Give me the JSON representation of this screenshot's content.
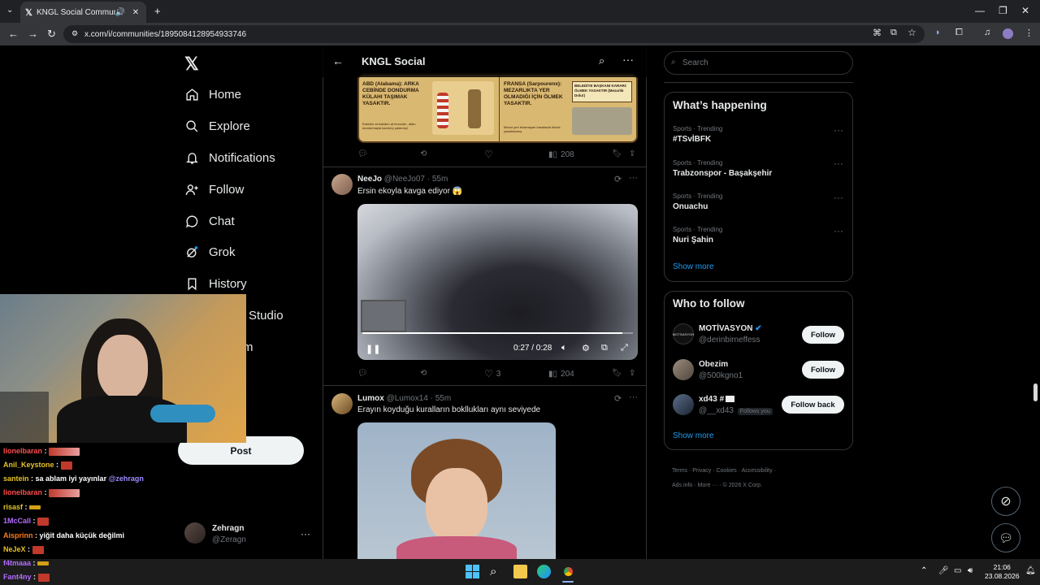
{
  "browser": {
    "tab_title": "KNGL Social Community / X",
    "url": "x.com/i/communities/1895084128954933746"
  },
  "nav": {
    "items": [
      {
        "label": "Home",
        "icon": "home-icon"
      },
      {
        "label": "Explore",
        "icon": "search-icon"
      },
      {
        "label": "Notifications",
        "icon": "bell-icon"
      },
      {
        "label": "Follow",
        "icon": "follow-icon"
      },
      {
        "label": "Chat",
        "icon": "chat-icon"
      },
      {
        "label": "Grok",
        "icon": "grok-icon"
      },
      {
        "label": "History",
        "icon": "bookmark-icon"
      },
      {
        "label": "Studio",
        "icon": "studio-icon"
      },
      {
        "label": "m",
        "icon": "premium-icon"
      }
    ],
    "post_label": "Post",
    "profile": {
      "name": "Zehragn",
      "handle": "@Zeragn"
    }
  },
  "main": {
    "title": "KNGL Social",
    "top_post": {
      "image_text_left": "ABD (Alabama): ARKA CEBİNDE DONDURMA KÜLAHI TAŞIMAK YASAKTIR.",
      "image_subtext_left": "Eskiden at eskiden at hırsızları, atları dondurmayla kandırıp çalarmış!",
      "image_text_right": "FRANSA (Sarpourenx): MEZARLIKTA YER OLMADIĞI İÇİN ÖLMEK YASAKTIR.",
      "image_subtext_right": "Mezar yeri bulamayan kasabada ölmek yasaklanmış",
      "image_sign": "BELEDİYE BAŞKANI KARARI: ÖLMEK YASAKTIR (Mezarlık Dolu!)",
      "views": "208"
    },
    "tweets": [
      {
        "name": "NeeJo",
        "handle": "@NeeJo07",
        "time": "· 55m",
        "text": "Ersin ekoyla kavga ediyor 😱",
        "video_time": "0:27 / 0:28",
        "video_progress": 0.96,
        "likes": "3",
        "views": "204"
      },
      {
        "name": "Lumox",
        "handle": "@Lumox14",
        "time": "· 55m",
        "text": "Erayın koyduğu kuralların bokllukları aynı seviyede"
      }
    ]
  },
  "right": {
    "search_placeholder": "Search",
    "happening_title": "What’s happening",
    "trends": [
      {
        "meta": "Sports · Trending",
        "name": "#TSvİBFK"
      },
      {
        "meta": "Sports · Trending",
        "name": "Trabzonspor - Başakşehir"
      },
      {
        "meta": "Sports · Trending",
        "name": "Onuachu"
      },
      {
        "meta": "Sports · Trending",
        "name": "Nuri Şahin"
      }
    ],
    "show_more": "Show more",
    "who_title": "Who to follow",
    "who": [
      {
        "name": "MOTİVASYON",
        "handle": "@derinbirneffess",
        "button": "Follow",
        "verified": true
      },
      {
        "name": "Obezim",
        "handle": "@500kgno1",
        "button": "Follow"
      },
      {
        "name": "xd43 #",
        "handle": "@__xd43",
        "badge": "Follows you",
        "button": "Follow back"
      }
    ],
    "show_more_2": "Show more",
    "footer": [
      "Terms",
      "Privacy",
      "Cookies",
      "Accessibility",
      "Ads info",
      "More ···",
      "© 2026 X Corp."
    ]
  },
  "chat": [
    {
      "user": "lionelbaran",
      "color": "#ff4d4d",
      "text": "",
      "emote": "wide"
    },
    {
      "user": "Anil_Keystone",
      "color": "#e6c229",
      "text": "",
      "emote": "small"
    },
    {
      "user": "santein",
      "color": "#e6c229",
      "text": "sa ablam iyi yayınlar",
      "mention": "@zehragn"
    },
    {
      "user": "lionelbaran",
      "color": "#ff4d4d",
      "text": "",
      "emote": "wide"
    },
    {
      "user": "risasf",
      "color": "#e6c229",
      "text": "",
      "emote": "ban"
    },
    {
      "user": "1McCall",
      "color": "#b46cff",
      "text": "",
      "emote": "small"
    },
    {
      "user": "Aisprinn",
      "color": "#ff7a1a",
      "text": "yiğit daha küçük değilmi"
    },
    {
      "user": "NeJeX",
      "color": "#e6c229",
      "text": "",
      "emote": "small"
    },
    {
      "user": "f4tmaaa",
      "color": "#b46cff",
      "text": "",
      "emote": "ban"
    },
    {
      "user": "Fant4ny",
      "color": "#b46cff",
      "text": "",
      "emote": "small"
    }
  ],
  "taskbar": {
    "time": "21:06",
    "date": "23.08.2026"
  },
  "colors": {
    "accent": "#1d9bf0",
    "border": "#2f3336",
    "muted": "#71767b"
  }
}
